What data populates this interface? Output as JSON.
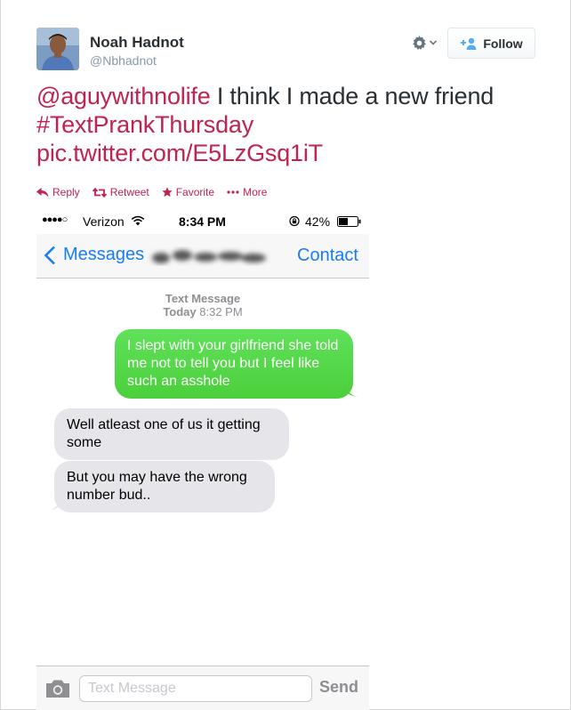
{
  "user": {
    "display_name": "Noah Hadnot",
    "screen_name": "@Nbhadnot"
  },
  "header": {
    "follow_label": "Follow"
  },
  "tweet": {
    "mention": "@aguywithnolife",
    "text": " I think I made a new friend",
    "hashtag": "#TextPrankThursday",
    "pic_link": "pic.twitter.com/E5LzGsq1iT"
  },
  "actions": {
    "reply": "Reply",
    "retweet": "Retweet",
    "favorite": "Favorite",
    "more": "More"
  },
  "phone": {
    "status": {
      "signal": "●●●●○",
      "carrier": "Verizon",
      "time": "8:34 PM",
      "battery": "42%"
    },
    "nav": {
      "back_label": "Messages",
      "contact_label": "Contact"
    },
    "conversation": {
      "type_label": "Text Message",
      "day_label": "Today",
      "time_label": "8:32 PM"
    },
    "messages": [
      {
        "direction": "out",
        "text": "I slept with your girlfriend she told me not to tell you but I feel like such an asshole"
      },
      {
        "direction": "in",
        "text": "Well atleast one of us it getting some"
      },
      {
        "direction": "in",
        "text": "But you may have the wrong number bud.."
      }
    ],
    "compose": {
      "placeholder": "Text Message",
      "send_label": "Send"
    }
  },
  "colors": {
    "link": "#c1224f",
    "imessage_green": "#4cd964",
    "ios_blue": "#1a7cf5",
    "bubble_gray": "#e5e5ea"
  }
}
